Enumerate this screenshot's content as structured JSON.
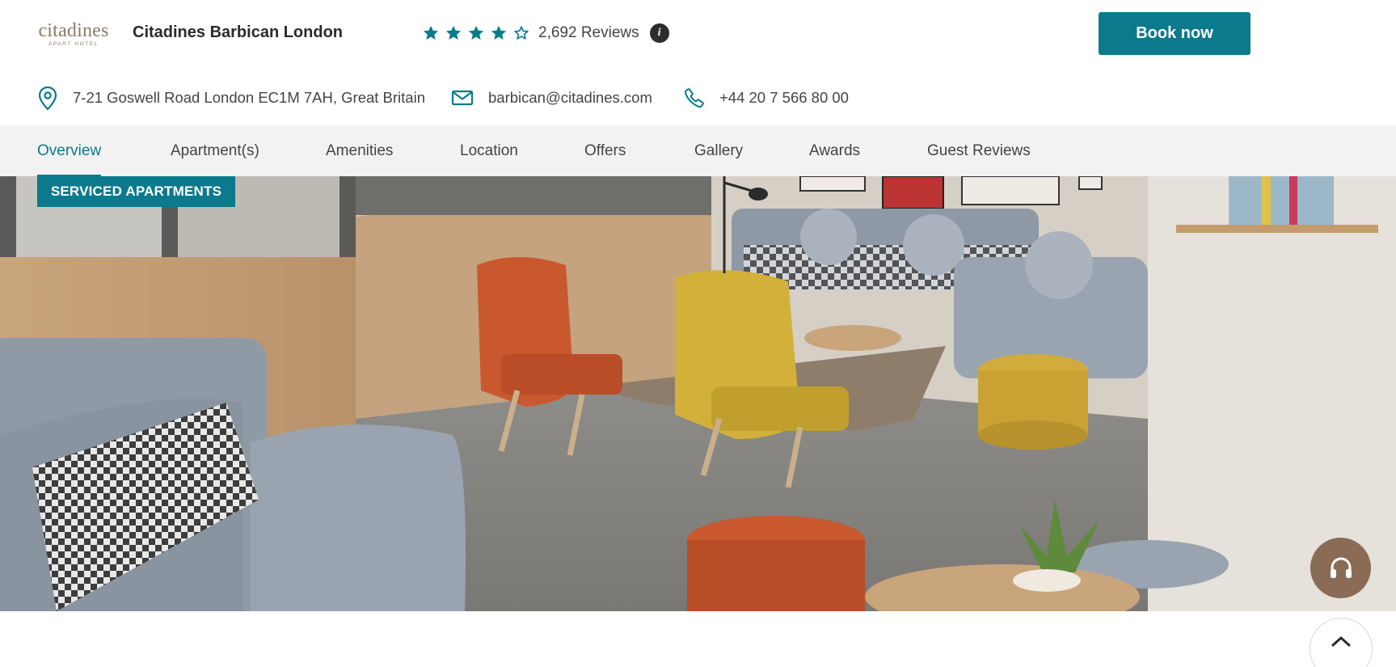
{
  "header": {
    "logo_text": "citadines",
    "logo_sub": "APART HOTEL",
    "hotel_name": "Citadines Barbican London",
    "rating_stars": 4,
    "rating_max": 5,
    "reviews_text": "2,692 Reviews",
    "info_icon": "info-icon",
    "book_label": "Book now"
  },
  "contact": {
    "address": "7-21 Goswell Road London EC1M 7AH, Great Britain",
    "email": "barbican@citadines.com",
    "phone": "+44 20 7 566 80 00"
  },
  "nav": {
    "tabs": [
      {
        "label": "Overview",
        "active": true
      },
      {
        "label": "Apartment(s)",
        "active": false
      },
      {
        "label": "Amenities",
        "active": false
      },
      {
        "label": "Location",
        "active": false
      },
      {
        "label": "Offers",
        "active": false
      },
      {
        "label": "Gallery",
        "active": false
      },
      {
        "label": "Awards",
        "active": false
      },
      {
        "label": "Guest Reviews",
        "active": false
      }
    ]
  },
  "hero": {
    "badge": "SERVICED APARTMENTS"
  },
  "floating": {
    "support_icon": "headset-icon",
    "top_icon": "chevron-up-icon"
  },
  "colors": {
    "accent": "#0a7a8c",
    "support": "#8a6b55",
    "nav_bg": "#f2f2f2"
  }
}
